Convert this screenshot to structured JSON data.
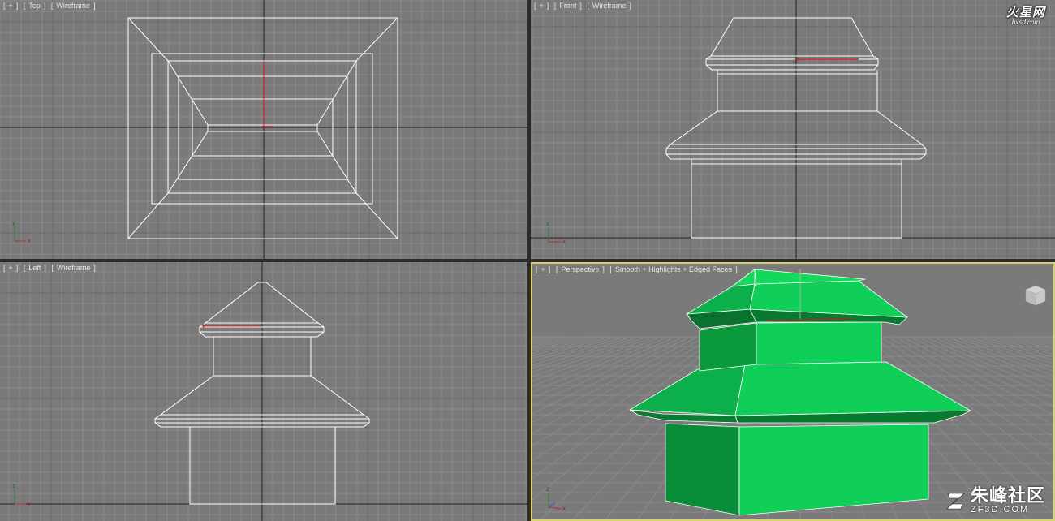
{
  "viewports": {
    "top": {
      "tag_plus": "+",
      "tag_view": "Top",
      "tag_mode": "Wireframe"
    },
    "front": {
      "tag_plus": "+",
      "tag_view": "Front",
      "tag_mode": "Wireframe"
    },
    "left": {
      "tag_plus": "+",
      "tag_view": "Left",
      "tag_mode": "Wireframe"
    },
    "perspective": {
      "tag_plus": "+",
      "tag_view": "Perspective",
      "tag_mode": "Smooth + Highlights + Edged Faces"
    }
  },
  "axis_labels": {
    "x": "x",
    "y": "y",
    "z": "z"
  },
  "watermarks": {
    "hxsd_brand": "火星网",
    "hxsd_url": "hxsd.com",
    "zf_cn": "朱峰社区",
    "zf_url": "ZF3D.COM"
  },
  "colors": {
    "viewport_bg": "#7a7a7a",
    "grid_minor": "#8a8a8a",
    "grid_major": "#202020",
    "wire": "#ffffff",
    "active_border": "#d8d36a",
    "object_green": "#10cf58",
    "object_green_dark": "#0a9a3c",
    "gizmo_red": "#e01010"
  },
  "icons": [
    "axis-tripod-icon",
    "viewcube-icon",
    "hxsd-logo-icon",
    "zf3d-logo-icon"
  ]
}
